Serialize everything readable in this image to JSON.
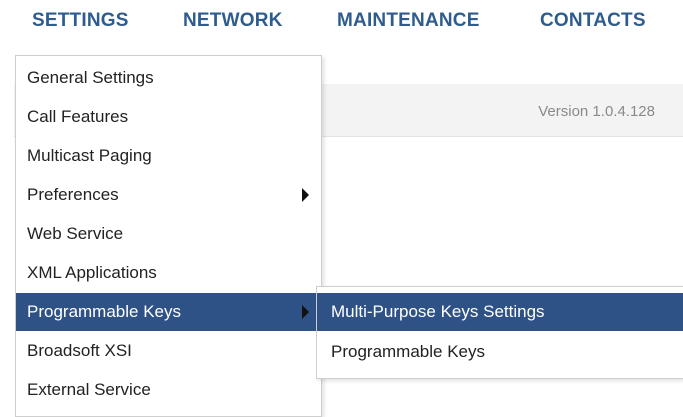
{
  "topnav": {
    "items": [
      {
        "label": "SETTINGS"
      },
      {
        "label": "NETWORK"
      },
      {
        "label": "MAINTENANCE"
      },
      {
        "label": "CONTACTS"
      }
    ]
  },
  "version_bar": {
    "text": "Version 1.0.4.128"
  },
  "settings_menu": {
    "items": [
      {
        "label": "General Settings",
        "has_submenu": false
      },
      {
        "label": "Call Features",
        "has_submenu": false
      },
      {
        "label": "Multicast Paging",
        "has_submenu": false
      },
      {
        "label": "Preferences",
        "has_submenu": true
      },
      {
        "label": "Web Service",
        "has_submenu": false
      },
      {
        "label": "XML Applications",
        "has_submenu": false
      },
      {
        "label": "Programmable Keys",
        "has_submenu": true,
        "active": true
      },
      {
        "label": "Broadsoft XSI",
        "has_submenu": false
      },
      {
        "label": "External Service",
        "has_submenu": false
      }
    ]
  },
  "programmable_keys_submenu": {
    "items": [
      {
        "label": "Multi-Purpose Keys Settings",
        "active": true
      },
      {
        "label": "Programmable Keys",
        "active": false
      }
    ]
  },
  "colors": {
    "nav_text": "#2f5c8f",
    "highlight": "#2e5186",
    "version_bar_bg": "#f3f3f3"
  }
}
